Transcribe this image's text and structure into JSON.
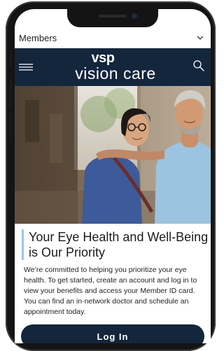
{
  "members_bar": {
    "label": "Members",
    "chevron_icon": "chevron-down-icon"
  },
  "header": {
    "background": "#14263c",
    "menu_icon": "hamburger-menu-icon",
    "logo": {
      "brand": "vsp",
      "name": "vision care"
    },
    "search_icon": "search-icon"
  },
  "hero": {
    "image": "photo-of-smiling-couple-wearing-glasses"
  },
  "main": {
    "title": "Your Eye Health and Well-Being is Our Priority",
    "body": "We’re committed to helping you prioritize your eye health. To get started, create an account and log in to view your benefits and access your Member ID card. You can find an in-network doctor and schedule an appointment today.",
    "accent_color": "#9cc6e6",
    "login_label": "Log In"
  }
}
